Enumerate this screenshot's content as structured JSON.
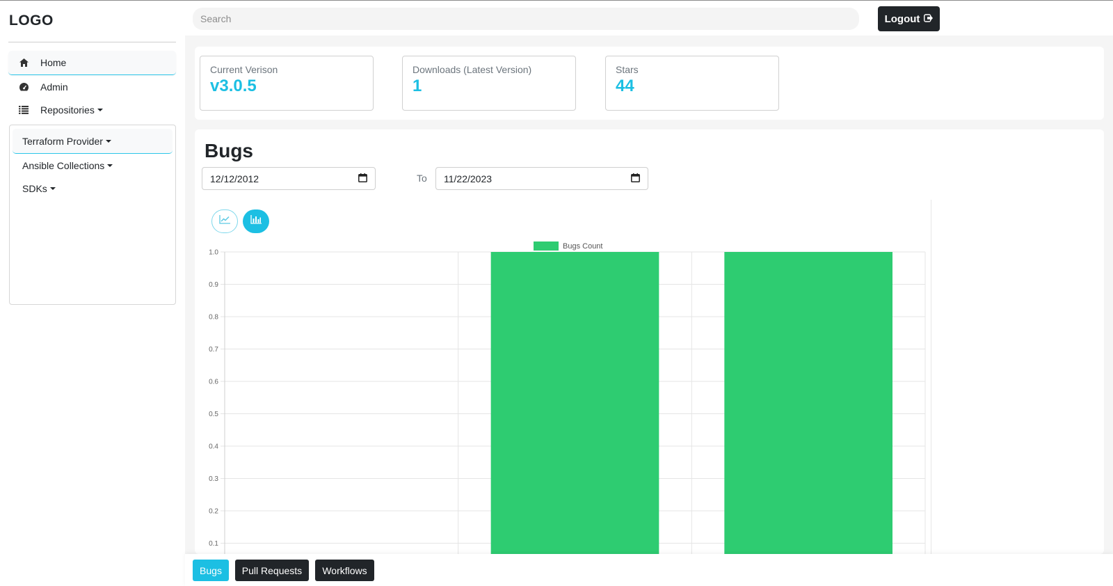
{
  "sidebar": {
    "logo": "LOGO",
    "items": [
      {
        "label": "Home",
        "icon": "home-icon"
      },
      {
        "label": "Admin",
        "icon": "dashboard-icon"
      },
      {
        "label": "Repositories",
        "icon": "list-icon"
      }
    ],
    "submenu": [
      {
        "label": "Terraform Provider"
      },
      {
        "label": "Ansible Collections"
      },
      {
        "label": "SDKs"
      }
    ]
  },
  "topbar": {
    "search_placeholder": "Search",
    "logout_label": "Logout"
  },
  "stats": [
    {
      "label": "Current Verison",
      "value": "v3.0.5"
    },
    {
      "label": "Downloads (Latest Version)",
      "value": "1"
    },
    {
      "label": "Stars",
      "value": "44"
    }
  ],
  "bugs": {
    "title": "Bugs",
    "from_date": "12/12/2012",
    "to_label": "To",
    "to_date": "11/22/2023"
  },
  "chart_data": {
    "type": "bar",
    "categories": [
      "",
      "",
      ""
    ],
    "series": [
      {
        "name": "Bugs Count",
        "values": [
          0,
          1,
          1
        ],
        "color": "#2ecc71"
      }
    ],
    "ylim": [
      0,
      1
    ],
    "yticks_visible": [
      "1.0",
      "0.9",
      "0.8",
      "0.7",
      "0.6",
      "0.5",
      "0.4",
      "0.3",
      "0.2",
      "0.1"
    ],
    "grid": true,
    "legend": "top-center"
  },
  "bottom_tabs": [
    {
      "label": "Bugs",
      "active": true
    },
    {
      "label": "Pull Requests",
      "active": false
    },
    {
      "label": "Workflows",
      "active": false
    }
  ],
  "colors": {
    "accent": "#1cbfe3",
    "dark": "#212529",
    "bar": "#2ecc71"
  }
}
